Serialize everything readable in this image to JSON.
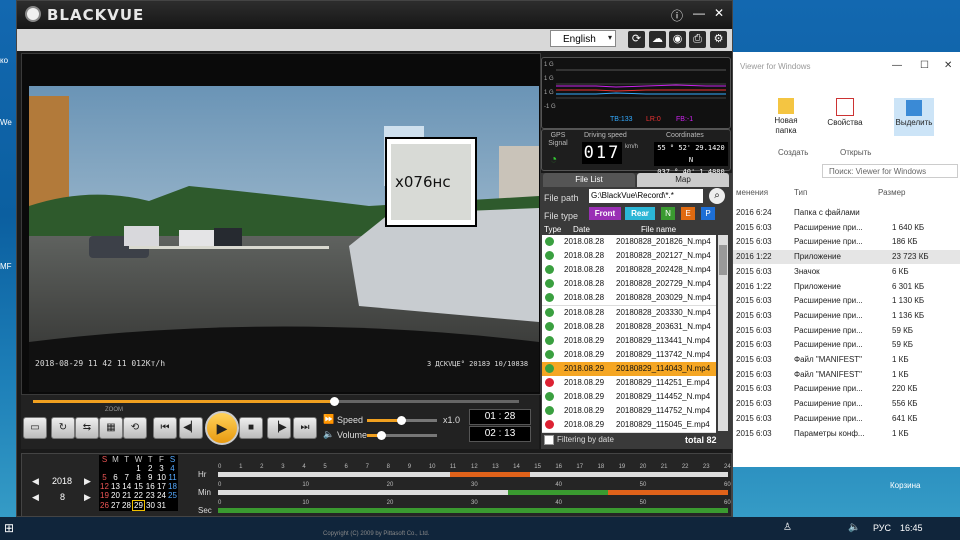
{
  "desktop": {
    "left_icons": [
      "ко",
      "We",
      "MF"
    ],
    "explorer": {
      "title": "Viewer for Windows",
      "ribbon": {
        "new_folder": "Новая папка",
        "properties": "Свойства",
        "select": "Выделить",
        "group_create": "Создать",
        "group_open": "Открыть"
      },
      "search_placeholder": "Поиск: Viewer for Windows",
      "columns": {
        "modified": "менения",
        "type": "Тип",
        "size": "Размер"
      },
      "rows": [
        {
          "date": "2016 6:24",
          "type": "Папка с файлами",
          "size": ""
        },
        {
          "date": "2015 6:03",
          "type": "Расширение при...",
          "size": "1 640 КБ"
        },
        {
          "date": "2015 6:03",
          "type": "Расширение при...",
          "size": "186 КБ"
        },
        {
          "date": "2016 1:22",
          "type": "Приложение",
          "size": "23 723 КБ"
        },
        {
          "date": "2015 6:03",
          "type": "Значок",
          "size": "6 КБ"
        },
        {
          "date": "2016 1:22",
          "type": "Приложение",
          "size": "6 301 КБ"
        },
        {
          "date": "2015 6:03",
          "type": "Расширение при...",
          "size": "1 130 КБ"
        },
        {
          "date": "2015 6:03",
          "type": "Расширение при...",
          "size": "1 136 КБ"
        },
        {
          "date": "2015 6:03",
          "type": "Расширение при...",
          "size": "59 КБ"
        },
        {
          "date": "2015 6:03",
          "type": "Расширение при...",
          "size": "59 КБ"
        },
        {
          "date": "2015 6:03",
          "type": "Файл \"MANIFEST\"",
          "size": "1 КБ"
        },
        {
          "date": "2015 6:03",
          "type": "Файл \"MANIFEST\"",
          "size": "1 КБ"
        },
        {
          "date": "2015 6:03",
          "type": "Расширение при...",
          "size": "220 КБ"
        },
        {
          "date": "2015 6:03",
          "type": "Расширение при...",
          "size": "556 КБ"
        },
        {
          "date": "2015 6:03",
          "type": "Расширение при...",
          "size": "641 КБ"
        },
        {
          "date": "2015 6:03",
          "type": "Параметры конф...",
          "size": "1 КБ"
        }
      ],
      "trash_label": "Корзина"
    }
  },
  "taskbar": {
    "lang": "РУС",
    "time": "16:45"
  },
  "app": {
    "logo": "BLACKVUE",
    "language": "English",
    "video": {
      "overlay_left": "2018-08-29 11 42 11 012Кт/h",
      "overlay_right": "3 ДСКVЦЕ° 2018Э 10/10838",
      "plate_text": "х076нс"
    },
    "gps": {
      "signal_label": "GPS Signal",
      "speed_label": "Driving speed",
      "speed_value": "017",
      "speed_unit": "km/h",
      "coord_label": "Coordinates",
      "lat": "55 ° 52' 29.1420 N",
      "lon": "037 ° 40' 1.4880 E"
    },
    "graph": {
      "tb": "TB:133",
      "lr": "LR:0",
      "fb": "FB:-1",
      "ticks": [
        "1 G",
        "1 G",
        "1 G",
        "-1 G"
      ]
    },
    "tabs": {
      "file_list": "File List",
      "map": "Map"
    },
    "file_path_label": "File path",
    "file_path": "G:\\BlackVue\\Record\\*.*",
    "file_type_label": "File type",
    "types": {
      "front": "Front",
      "rear": "Rear",
      "n": "N",
      "e": "E",
      "p": "P"
    },
    "list_header": {
      "type": "Type",
      "date": "Date",
      "name": "File name"
    },
    "files": [
      {
        "date": "2018.08.28",
        "name": "20180828_201826_N.mp4",
        "event": false
      },
      {
        "date": "2018.08.28",
        "name": "20180828_202127_N.mp4",
        "event": false
      },
      {
        "date": "2018.08.28",
        "name": "20180828_202428_N.mp4",
        "event": false
      },
      {
        "date": "2018.08.28",
        "name": "20180828_202729_N.mp4",
        "event": false
      },
      {
        "date": "2018.08.28",
        "name": "20180828_203029_N.mp4",
        "event": false
      },
      {
        "date": "2018.08.28",
        "name": "20180828_203330_N.mp4",
        "event": false
      },
      {
        "date": "2018.08.28",
        "name": "20180828_203631_N.mp4",
        "event": false
      },
      {
        "date": "2018.08.29",
        "name": "20180829_113441_N.mp4",
        "event": false
      },
      {
        "date": "2018.08.29",
        "name": "20180829_113742_N.mp4",
        "event": false
      },
      {
        "date": "2018.08.29",
        "name": "20180829_114043_N.mp4",
        "event": false
      },
      {
        "date": "2018.08.29",
        "name": "20180829_114251_E.mp4",
        "event": true
      },
      {
        "date": "2018.08.29",
        "name": "20180829_114452_N.mp4",
        "event": false
      },
      {
        "date": "2018.08.29",
        "name": "20180829_114752_N.mp4",
        "event": false
      },
      {
        "date": "2018.08.29",
        "name": "20180829_115045_E.mp4",
        "event": true
      }
    ],
    "selected_file_index": 9,
    "filtering_label": "Filtering by date",
    "total": "total 82",
    "playback": {
      "position": 0.62,
      "speed_label": "Speed",
      "speed_value": "x1.0",
      "volume_label": "Volume",
      "time_current": "01 : 28",
      "time_total": "02 : 13",
      "zoom_label": "ZOOM"
    },
    "calendar": {
      "year": "2018",
      "month": "8",
      "weekdays": [
        "S",
        "M",
        "T",
        "W",
        "T",
        "F",
        "S"
      ],
      "weeks": [
        [
          "",
          "",
          "",
          "1",
          "2",
          "3",
          "4"
        ],
        [
          "5",
          "6",
          "7",
          "8",
          "9",
          "10",
          "11"
        ],
        [
          "12",
          "13",
          "14",
          "15",
          "16",
          "17",
          "18"
        ],
        [
          "19",
          "20",
          "21",
          "22",
          "23",
          "24",
          "25"
        ],
        [
          "26",
          "27",
          "28",
          "29",
          "30",
          "31",
          ""
        ]
      ],
      "selected_day": "29"
    },
    "timeline": {
      "hr_label": "Hr",
      "min_label": "Min",
      "sec_label": "Sec",
      "hr_ticks": [
        "0",
        "1",
        "2",
        "3",
        "4",
        "5",
        "6",
        "7",
        "8",
        "9",
        "10",
        "11",
        "12",
        "13",
        "14",
        "15",
        "16",
        "17",
        "18",
        "19",
        "20",
        "21",
        "22",
        "23",
        "24"
      ],
      "min_ticks": [
        "0",
        "10",
        "20",
        "30",
        "40",
        "50",
        "60"
      ],
      "sec_ticks": [
        "0",
        "10",
        "20",
        "30",
        "40",
        "50",
        "60"
      ]
    },
    "copyright": "Copyright (C) 2009 by Pittasoft Co., Ltd."
  }
}
